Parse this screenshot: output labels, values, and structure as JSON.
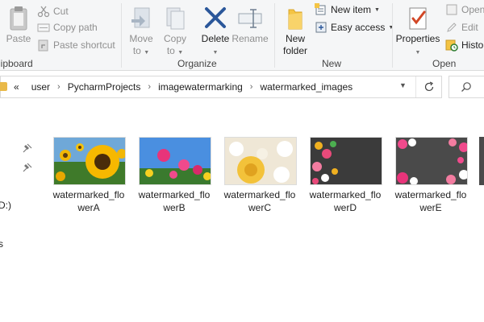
{
  "ribbon": {
    "clipboard": {
      "paste_label": "Paste",
      "cut_label": "Cut",
      "copy_path_label": "Copy path",
      "paste_shortcut_label": "Paste shortcut",
      "group_label": "lipboard"
    },
    "organize": {
      "move_to_label": "Move",
      "move_to_sub": "to",
      "copy_to_label": "Copy",
      "copy_to_sub": "to",
      "delete_label": "Delete",
      "rename_label": "Rename",
      "group_label": "Organize"
    },
    "new": {
      "new_folder_label": "New",
      "new_folder_sub": "folder",
      "new_item_label": "New item",
      "easy_access_label": "Easy access",
      "group_label": "New"
    },
    "open": {
      "properties_label": "Properties",
      "open_label": "Open",
      "edit_label": "Edit",
      "history_label": "Histor",
      "group_label": "Open"
    }
  },
  "address_bar": {
    "overflow": "«",
    "breadcrumb": [
      "user",
      "PycharmProjects",
      "imagewatermarking",
      "watermarked_images"
    ]
  },
  "nav_pane": {
    "drive_fragment": "D:)",
    "item_fragment": "s"
  },
  "files": [
    {
      "line1": "watermarked_flo",
      "line2": "werA",
      "thumb": "sunflower"
    },
    {
      "line1": "watermarked_flo",
      "line2": "werB",
      "thumb": "pink-field"
    },
    {
      "line1": "watermarked_flo",
      "line2": "werC",
      "thumb": "yellow-rose"
    },
    {
      "line1": "watermarked_flo",
      "line2": "werD",
      "thumb": "dark-bouquet"
    },
    {
      "line1": "watermarked_flo",
      "line2": "werE",
      "thumb": "pink-frame"
    }
  ],
  "colors": {
    "ribbon_bg": "#f5f6f7",
    "folder_yellow": "#e9b949",
    "delete_blue": "#2b579a",
    "properties_red": "#d24726"
  }
}
